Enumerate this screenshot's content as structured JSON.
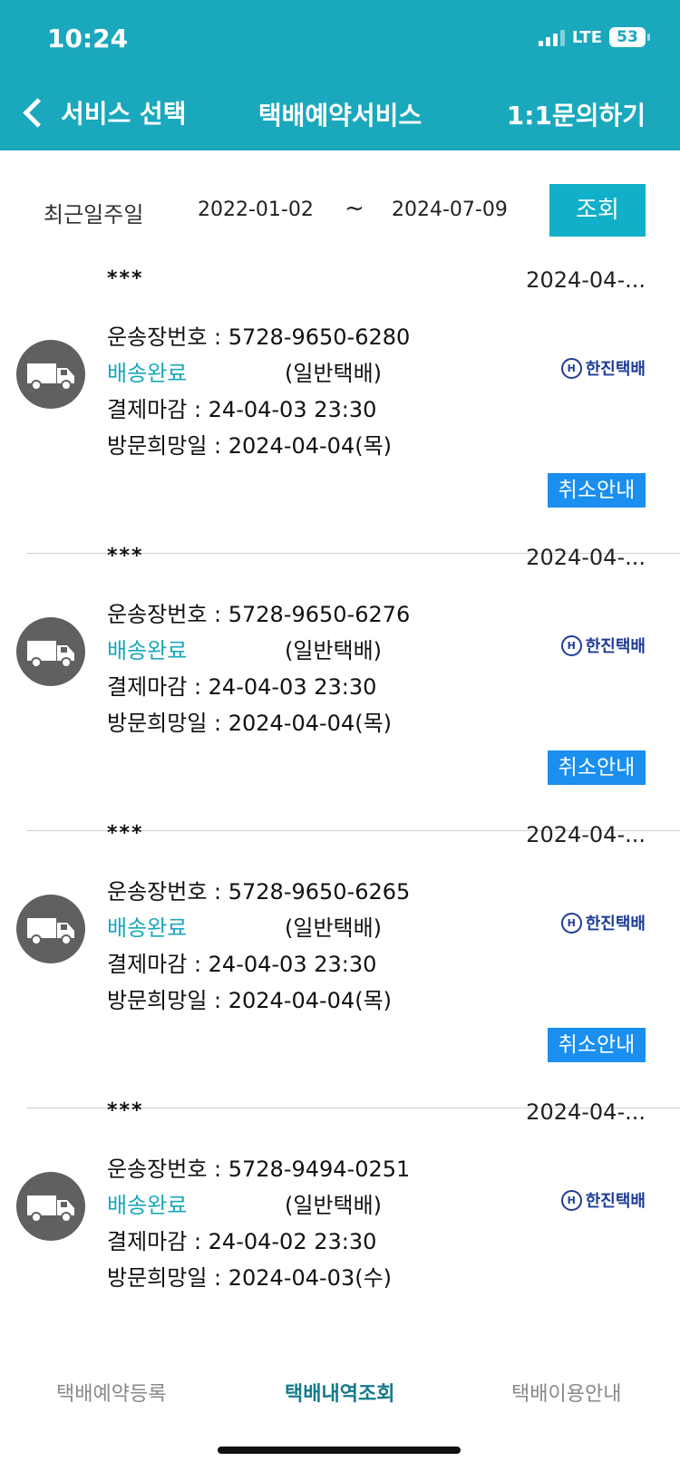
{
  "status_bar": {
    "time": "10:24",
    "network": "LTE",
    "battery": "53"
  },
  "header": {
    "back_label": "서비스 선택",
    "title": "택배예약서비스",
    "inquiry_label": "1:1문의하기"
  },
  "filter": {
    "period_label": "최근일주일",
    "date_from": "2022-01-02",
    "separator": "~",
    "date_to": "2024-07-09",
    "search_label": "조회"
  },
  "orders": [
    {
      "name": "***",
      "date": "2024-04-...",
      "tracking": "운송장번호 : 5728-9650-6280",
      "status": "배송완료",
      "type": "(일반택배)",
      "carrier": "한진택배",
      "carrier_mark": "H",
      "deadline": "결제마감 : 24-04-03 23:30",
      "visit": "방문희망일 : 2024-04-04(목)",
      "cancel_label": "취소안내"
    },
    {
      "name": "***",
      "date": "2024-04-...",
      "tracking": "운송장번호 : 5728-9650-6276",
      "status": "배송완료",
      "type": "(일반택배)",
      "carrier": "한진택배",
      "carrier_mark": "H",
      "deadline": "결제마감 : 24-04-03 23:30",
      "visit": "방문희망일 : 2024-04-04(목)",
      "cancel_label": "취소안내"
    },
    {
      "name": "***",
      "date": "2024-04-...",
      "tracking": "운송장번호 : 5728-9650-6265",
      "status": "배송완료",
      "type": "(일반택배)",
      "carrier": "한진택배",
      "carrier_mark": "H",
      "deadline": "결제마감 : 24-04-03 23:30",
      "visit": "방문희망일 : 2024-04-04(목)",
      "cancel_label": "취소안내"
    },
    {
      "name": "***",
      "date": "2024-04-...",
      "tracking": "운송장번호 : 5728-9494-0251",
      "status": "배송완료",
      "type": "(일반택배)",
      "carrier": "한진택배",
      "carrier_mark": "H",
      "deadline": "결제마감 : 24-04-02 23:30",
      "visit": "방문희망일 : 2024-04-03(수)"
    }
  ],
  "tabs": [
    {
      "label": "택배예약등록"
    },
    {
      "label": "택배내역조회"
    },
    {
      "label": "택배이용안내"
    }
  ],
  "colors": {
    "primary": "#1aa8bd",
    "button": "#12b0c8",
    "cancel_button": "#1a8ff0",
    "carrier": "#1e3c96"
  }
}
